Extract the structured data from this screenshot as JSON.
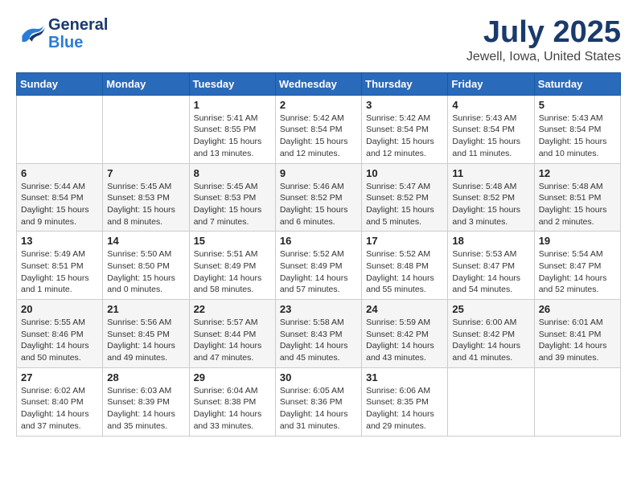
{
  "header": {
    "logo_general": "General",
    "logo_blue": "Blue",
    "month_title": "July 2025",
    "location": "Jewell, Iowa, United States"
  },
  "weekdays": [
    "Sunday",
    "Monday",
    "Tuesday",
    "Wednesday",
    "Thursday",
    "Friday",
    "Saturday"
  ],
  "weeks": [
    [
      {
        "day": "",
        "sunrise": "",
        "sunset": "",
        "daylight": ""
      },
      {
        "day": "",
        "sunrise": "",
        "sunset": "",
        "daylight": ""
      },
      {
        "day": "1",
        "sunrise": "Sunrise: 5:41 AM",
        "sunset": "Sunset: 8:55 PM",
        "daylight": "Daylight: 15 hours and 13 minutes."
      },
      {
        "day": "2",
        "sunrise": "Sunrise: 5:42 AM",
        "sunset": "Sunset: 8:54 PM",
        "daylight": "Daylight: 15 hours and 12 minutes."
      },
      {
        "day": "3",
        "sunrise": "Sunrise: 5:42 AM",
        "sunset": "Sunset: 8:54 PM",
        "daylight": "Daylight: 15 hours and 12 minutes."
      },
      {
        "day": "4",
        "sunrise": "Sunrise: 5:43 AM",
        "sunset": "Sunset: 8:54 PM",
        "daylight": "Daylight: 15 hours and 11 minutes."
      },
      {
        "day": "5",
        "sunrise": "Sunrise: 5:43 AM",
        "sunset": "Sunset: 8:54 PM",
        "daylight": "Daylight: 15 hours and 10 minutes."
      }
    ],
    [
      {
        "day": "6",
        "sunrise": "Sunrise: 5:44 AM",
        "sunset": "Sunset: 8:54 PM",
        "daylight": "Daylight: 15 hours and 9 minutes."
      },
      {
        "day": "7",
        "sunrise": "Sunrise: 5:45 AM",
        "sunset": "Sunset: 8:53 PM",
        "daylight": "Daylight: 15 hours and 8 minutes."
      },
      {
        "day": "8",
        "sunrise": "Sunrise: 5:45 AM",
        "sunset": "Sunset: 8:53 PM",
        "daylight": "Daylight: 15 hours and 7 minutes."
      },
      {
        "day": "9",
        "sunrise": "Sunrise: 5:46 AM",
        "sunset": "Sunset: 8:52 PM",
        "daylight": "Daylight: 15 hours and 6 minutes."
      },
      {
        "day": "10",
        "sunrise": "Sunrise: 5:47 AM",
        "sunset": "Sunset: 8:52 PM",
        "daylight": "Daylight: 15 hours and 5 minutes."
      },
      {
        "day": "11",
        "sunrise": "Sunrise: 5:48 AM",
        "sunset": "Sunset: 8:52 PM",
        "daylight": "Daylight: 15 hours and 3 minutes."
      },
      {
        "day": "12",
        "sunrise": "Sunrise: 5:48 AM",
        "sunset": "Sunset: 8:51 PM",
        "daylight": "Daylight: 15 hours and 2 minutes."
      }
    ],
    [
      {
        "day": "13",
        "sunrise": "Sunrise: 5:49 AM",
        "sunset": "Sunset: 8:51 PM",
        "daylight": "Daylight: 15 hours and 1 minute."
      },
      {
        "day": "14",
        "sunrise": "Sunrise: 5:50 AM",
        "sunset": "Sunset: 8:50 PM",
        "daylight": "Daylight: 15 hours and 0 minutes."
      },
      {
        "day": "15",
        "sunrise": "Sunrise: 5:51 AM",
        "sunset": "Sunset: 8:49 PM",
        "daylight": "Daylight: 14 hours and 58 minutes."
      },
      {
        "day": "16",
        "sunrise": "Sunrise: 5:52 AM",
        "sunset": "Sunset: 8:49 PM",
        "daylight": "Daylight: 14 hours and 57 minutes."
      },
      {
        "day": "17",
        "sunrise": "Sunrise: 5:52 AM",
        "sunset": "Sunset: 8:48 PM",
        "daylight": "Daylight: 14 hours and 55 minutes."
      },
      {
        "day": "18",
        "sunrise": "Sunrise: 5:53 AM",
        "sunset": "Sunset: 8:47 PM",
        "daylight": "Daylight: 14 hours and 54 minutes."
      },
      {
        "day": "19",
        "sunrise": "Sunrise: 5:54 AM",
        "sunset": "Sunset: 8:47 PM",
        "daylight": "Daylight: 14 hours and 52 minutes."
      }
    ],
    [
      {
        "day": "20",
        "sunrise": "Sunrise: 5:55 AM",
        "sunset": "Sunset: 8:46 PM",
        "daylight": "Daylight: 14 hours and 50 minutes."
      },
      {
        "day": "21",
        "sunrise": "Sunrise: 5:56 AM",
        "sunset": "Sunset: 8:45 PM",
        "daylight": "Daylight: 14 hours and 49 minutes."
      },
      {
        "day": "22",
        "sunrise": "Sunrise: 5:57 AM",
        "sunset": "Sunset: 8:44 PM",
        "daylight": "Daylight: 14 hours and 47 minutes."
      },
      {
        "day": "23",
        "sunrise": "Sunrise: 5:58 AM",
        "sunset": "Sunset: 8:43 PM",
        "daylight": "Daylight: 14 hours and 45 minutes."
      },
      {
        "day": "24",
        "sunrise": "Sunrise: 5:59 AM",
        "sunset": "Sunset: 8:42 PM",
        "daylight": "Daylight: 14 hours and 43 minutes."
      },
      {
        "day": "25",
        "sunrise": "Sunrise: 6:00 AM",
        "sunset": "Sunset: 8:42 PM",
        "daylight": "Daylight: 14 hours and 41 minutes."
      },
      {
        "day": "26",
        "sunrise": "Sunrise: 6:01 AM",
        "sunset": "Sunset: 8:41 PM",
        "daylight": "Daylight: 14 hours and 39 minutes."
      }
    ],
    [
      {
        "day": "27",
        "sunrise": "Sunrise: 6:02 AM",
        "sunset": "Sunset: 8:40 PM",
        "daylight": "Daylight: 14 hours and 37 minutes."
      },
      {
        "day": "28",
        "sunrise": "Sunrise: 6:03 AM",
        "sunset": "Sunset: 8:39 PM",
        "daylight": "Daylight: 14 hours and 35 minutes."
      },
      {
        "day": "29",
        "sunrise": "Sunrise: 6:04 AM",
        "sunset": "Sunset: 8:38 PM",
        "daylight": "Daylight: 14 hours and 33 minutes."
      },
      {
        "day": "30",
        "sunrise": "Sunrise: 6:05 AM",
        "sunset": "Sunset: 8:36 PM",
        "daylight": "Daylight: 14 hours and 31 minutes."
      },
      {
        "day": "31",
        "sunrise": "Sunrise: 6:06 AM",
        "sunset": "Sunset: 8:35 PM",
        "daylight": "Daylight: 14 hours and 29 minutes."
      },
      {
        "day": "",
        "sunrise": "",
        "sunset": "",
        "daylight": ""
      },
      {
        "day": "",
        "sunrise": "",
        "sunset": "",
        "daylight": ""
      }
    ]
  ]
}
